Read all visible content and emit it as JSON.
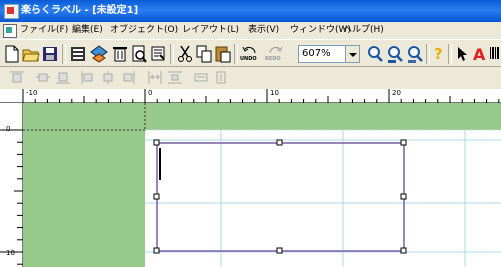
{
  "window": {
    "title": "楽らくラベル - [未設定1]"
  },
  "menu": {
    "items": [
      {
        "label": "ファイル(F)"
      },
      {
        "label": "編集(E)"
      },
      {
        "label": "オブジェクト(O)"
      },
      {
        "label": "レイアウト(L)"
      },
      {
        "label": "表示(V)"
      },
      {
        "label": "ウィンドウ(W)"
      },
      {
        "label": "ヘルプ(H)"
      }
    ]
  },
  "toolbar": {
    "undo_label": "UNDO",
    "redo_label": "REDO",
    "zoom_value": "607%",
    "icons": [
      "new-file-icon",
      "open-folder-icon",
      "save-icon",
      "print-setup-icon",
      "layer-icon",
      "bin-icon",
      "print-preview-icon",
      "template-icon",
      "cut-icon",
      "copy-icon",
      "paste-icon",
      "undo-icon",
      "redo-icon",
      "zoom-icon",
      "zoom-all-icon",
      "zoom-page-icon",
      "help-icon",
      "pointer-icon",
      "text-tool-icon",
      "barcode-icon"
    ]
  },
  "ruler": {
    "horizontal_labels": [
      "-10",
      "0",
      "10",
      "20"
    ],
    "vertical_labels": [
      "0",
      "10"
    ]
  },
  "colors": {
    "title_bar": "#0a5bd6",
    "workspace_green": "#97c98a",
    "label_border": "#7a5ea6",
    "grid_line": "#a9d8e6"
  }
}
